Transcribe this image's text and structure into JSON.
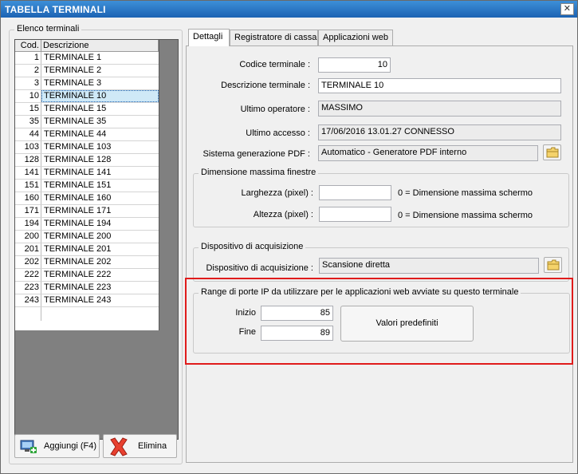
{
  "window": {
    "title": "TABELLA TERMINALI",
    "close_glyph": "✕"
  },
  "left": {
    "group_title": "Elenco terminali",
    "columns": [
      "Cod.",
      "Descrizione"
    ],
    "rows": [
      {
        "cod": "1",
        "desc": "TERMINALE 1"
      },
      {
        "cod": "2",
        "desc": "TERMINALE 2"
      },
      {
        "cod": "3",
        "desc": "TERMINALE 3"
      },
      {
        "cod": "10",
        "desc": "TERMINALE 10"
      },
      {
        "cod": "15",
        "desc": "TERMINALE 15"
      },
      {
        "cod": "35",
        "desc": "TERMINALE 35"
      },
      {
        "cod": "44",
        "desc": "TERMINALE 44"
      },
      {
        "cod": "103",
        "desc": "TERMINALE 103"
      },
      {
        "cod": "128",
        "desc": "TERMINALE 128"
      },
      {
        "cod": "141",
        "desc": "TERMINALE 141"
      },
      {
        "cod": "151",
        "desc": "TERMINALE 151"
      },
      {
        "cod": "160",
        "desc": "TERMINALE 160"
      },
      {
        "cod": "171",
        "desc": "TERMINALE 171"
      },
      {
        "cod": "194",
        "desc": "TERMINALE 194"
      },
      {
        "cod": "200",
        "desc": "TERMINALE 200"
      },
      {
        "cod": "201",
        "desc": "TERMINALE 201"
      },
      {
        "cod": "202",
        "desc": "TERMINALE 202"
      },
      {
        "cod": "222",
        "desc": "TERMINALE 222"
      },
      {
        "cod": "223",
        "desc": "TERMINALE 223"
      },
      {
        "cod": "243",
        "desc": "TERMINALE 243"
      }
    ],
    "selected_cod": "10",
    "add_button": "Aggiungi (F4)",
    "delete_button": "Elimina"
  },
  "tabs": [
    "Dettagli",
    "Registratore di cassa",
    "Applicazioni web"
  ],
  "details": {
    "codice_label": "Codice terminale :",
    "codice_value": "10",
    "descrizione_label": "Descrizione terminale :",
    "descrizione_value": "TERMINALE 10",
    "operatore_label": "Ultimo operatore :",
    "operatore_value": "MASSIMO",
    "accesso_label": "Ultimo accesso :",
    "accesso_value": "17/06/2016  13.01.27  CONNESSO",
    "pdf_label": "Sistema generazione PDF :",
    "pdf_value": "Automatico - Generatore PDF interno",
    "dimensione": {
      "title": "Dimensione massima finestre",
      "larghezza_label": "Larghezza (pixel) :",
      "larghezza_value": "",
      "altezza_label": "Altezza (pixel) :",
      "altezza_value": "",
      "hint": "0 = Dimensione massima schermo"
    },
    "acquisizione": {
      "title": "Dispositivo di acquisizione",
      "label": "Dispositivo di acquisizione :",
      "value": "Scansione diretta"
    },
    "porte": {
      "title": "Range di porte IP da utilizzare per le applicazioni web avviate su questo terminale",
      "inizio_label": "Inizio",
      "inizio_value": "85",
      "fine_label": "Fine",
      "fine_value": "89",
      "default_button": "Valori predefiniti"
    }
  },
  "colors": {
    "titlebar": "#1c63b3",
    "highlight_frame": "#e01b1b",
    "selection": "#cfe9f7"
  }
}
